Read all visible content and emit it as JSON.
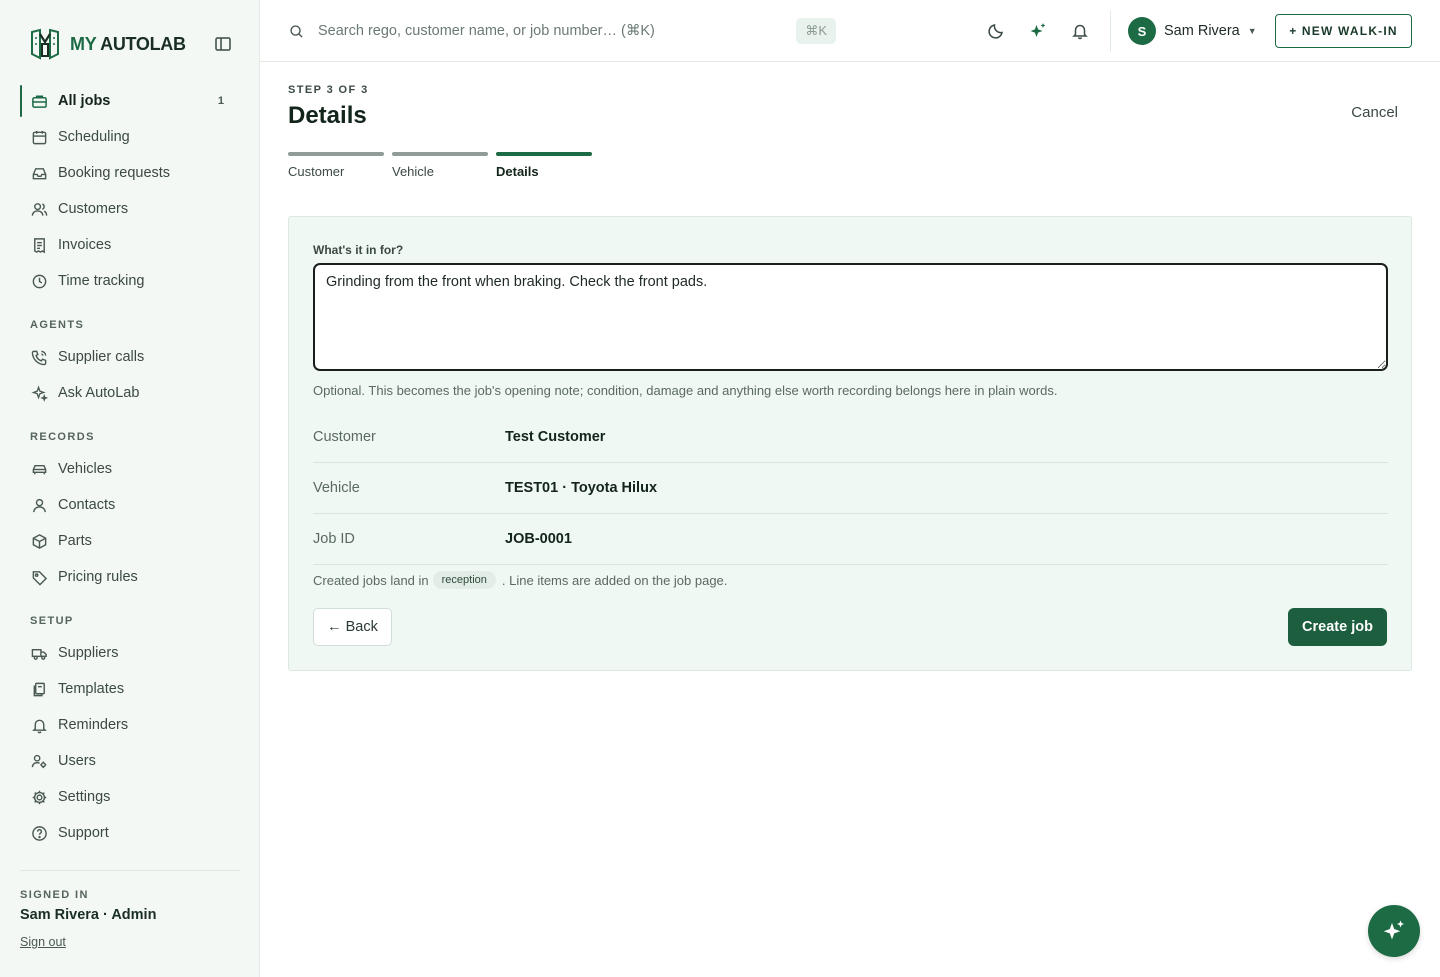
{
  "brand": {
    "my": "MY",
    "rest": "AUTOLAB",
    "logo_icon": "shield-wrench-logo"
  },
  "sidebar": {
    "items": [
      {
        "label": "All jobs",
        "icon": "briefcase-icon",
        "count": "1",
        "active": true
      },
      {
        "label": "Scheduling",
        "icon": "calendar-icon"
      },
      {
        "label": "Booking requests",
        "icon": "inbox-icon"
      },
      {
        "label": "Customers",
        "icon": "users-icon"
      },
      {
        "label": "Invoices",
        "icon": "receipt-icon"
      },
      {
        "label": "Time tracking",
        "icon": "clock-icon"
      }
    ],
    "agents_label": "AGENTS",
    "agents": [
      {
        "label": "Supplier calls",
        "icon": "phone-call-icon"
      },
      {
        "label": "Ask AutoLab",
        "icon": "sparkle-icon"
      }
    ],
    "records_label": "RECORDS",
    "records": [
      {
        "label": "Vehicles",
        "icon": "car-icon"
      },
      {
        "label": "Contacts",
        "icon": "user-icon"
      },
      {
        "label": "Parts",
        "icon": "package-icon"
      },
      {
        "label": "Pricing rules",
        "icon": "tag-icon"
      }
    ],
    "setup_label": "SETUP",
    "setup": [
      {
        "label": "Suppliers",
        "icon": "truck-icon"
      },
      {
        "label": "Templates",
        "icon": "copy-icon"
      },
      {
        "label": "Reminders",
        "icon": "bell-icon"
      },
      {
        "label": "Users",
        "icon": "users-cog-icon"
      },
      {
        "label": "Settings",
        "icon": "gear-icon"
      },
      {
        "label": "Support",
        "icon": "help-circle-icon"
      }
    ],
    "signed_in_label": "SIGNED IN",
    "signed_in_user": "Sam Rivera · Admin",
    "sign_out": "Sign out"
  },
  "topbar": {
    "search_placeholder": "Search rego, customer name, or job number… (⌘K)",
    "shortcut": "⌘K",
    "user_initial": "S",
    "user_name": "Sam Rivera",
    "new_walkin": "+ NEW WALK-IN"
  },
  "page": {
    "step": "STEP 3 OF 3",
    "title": "Details",
    "cancel": "Cancel",
    "steps": [
      {
        "label": "Customer"
      },
      {
        "label": "Vehicle"
      },
      {
        "label": "Details",
        "active": true
      }
    ],
    "form": {
      "field_label": "What's it in for?",
      "field_value": "Grinding from the front when braking. Check the front pads.",
      "help": "Optional. This becomes the job's opening note; condition, damage and anything else worth recording belongs here in plain words.",
      "summary": [
        {
          "key": "Customer",
          "value": "Test Customer"
        },
        {
          "key": "Vehicle",
          "value": "TEST01 · Toyota Hilux"
        },
        {
          "key": "Job ID",
          "value": "JOB-0001"
        }
      ],
      "note_before": "Created jobs land in",
      "note_pill": "reception",
      "note_after": ". Line items are added on the job page.",
      "back": "← Back",
      "create": "Create job"
    }
  },
  "colors": {
    "brand": "#1d6b45",
    "brand_dark": "#1d5e3e",
    "card_bg": "#f0f8f3",
    "sidebar_bg": "#f4f8f5"
  }
}
